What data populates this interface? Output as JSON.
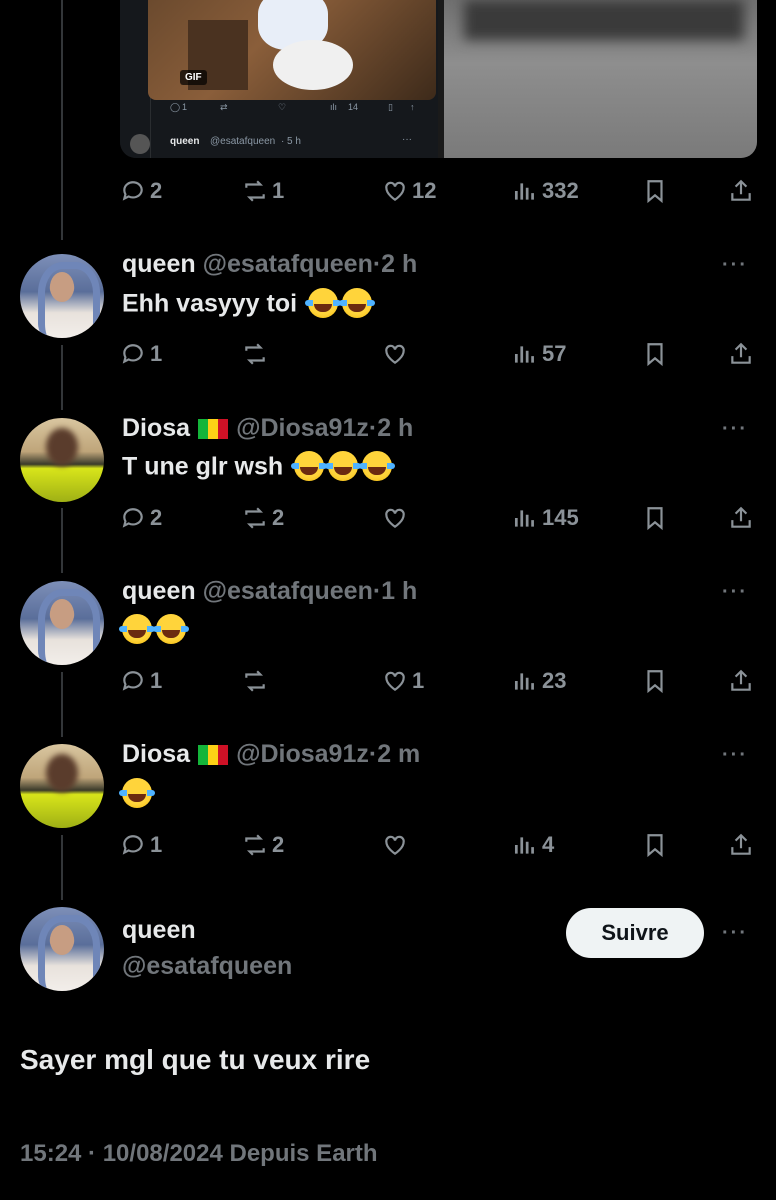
{
  "embedded": {
    "gif_label": "GIF",
    "mini_actions": {
      "replies": "1",
      "views": "14"
    },
    "mini_reply": {
      "name": "queen",
      "handle": "@esatafqueen",
      "time": "5 h",
      "more": "···"
    }
  },
  "top_actions": {
    "replies": "2",
    "reposts": "1",
    "likes": "12",
    "views": "332"
  },
  "replies": [
    {
      "name": "queen",
      "handle": "@esatafqueen",
      "time": "2 h",
      "text": "Ehh vasyyy toi",
      "emoji_count": 2,
      "actions": {
        "replies": "1",
        "reposts": "",
        "likes": "",
        "views": "57"
      }
    },
    {
      "name": "Diosa",
      "handle": "@Diosa91z",
      "time": "2 h",
      "text": "T une glr wsh",
      "emoji_count": 3,
      "actions": {
        "replies": "2",
        "reposts": "2",
        "likes": "",
        "views": "145"
      }
    },
    {
      "name": "queen",
      "handle": "@esatafqueen",
      "time": "1 h",
      "text": "",
      "emoji_count": 2,
      "actions": {
        "replies": "1",
        "reposts": "",
        "likes": "1",
        "views": "23"
      }
    },
    {
      "name": "Diosa",
      "handle": "@Diosa91z",
      "time": "2 m",
      "text": "",
      "emoji_count": 1,
      "actions": {
        "replies": "1",
        "reposts": "2",
        "likes": "",
        "views": "4"
      }
    }
  ],
  "main_tweet": {
    "name": "queen",
    "handle": "@esatafqueen",
    "follow_label": "Suivre",
    "more": "···",
    "text": "Sayer mgl que tu veux rire",
    "meta": "15:24 · 10/08/2024 Depuis Earth"
  },
  "more_label": "···",
  "dot": "·",
  "colors": {
    "background": "#000000",
    "text": "#e7e9ea",
    "muted": "#71767b",
    "follow_bg": "#eff3f4",
    "mali_flag": [
      "#14b53a",
      "#fcd116",
      "#ce1126"
    ]
  },
  "icons": [
    "reply-icon",
    "repost-icon",
    "like-icon",
    "views-icon",
    "bookmark-icon",
    "share-icon",
    "more-icon"
  ]
}
